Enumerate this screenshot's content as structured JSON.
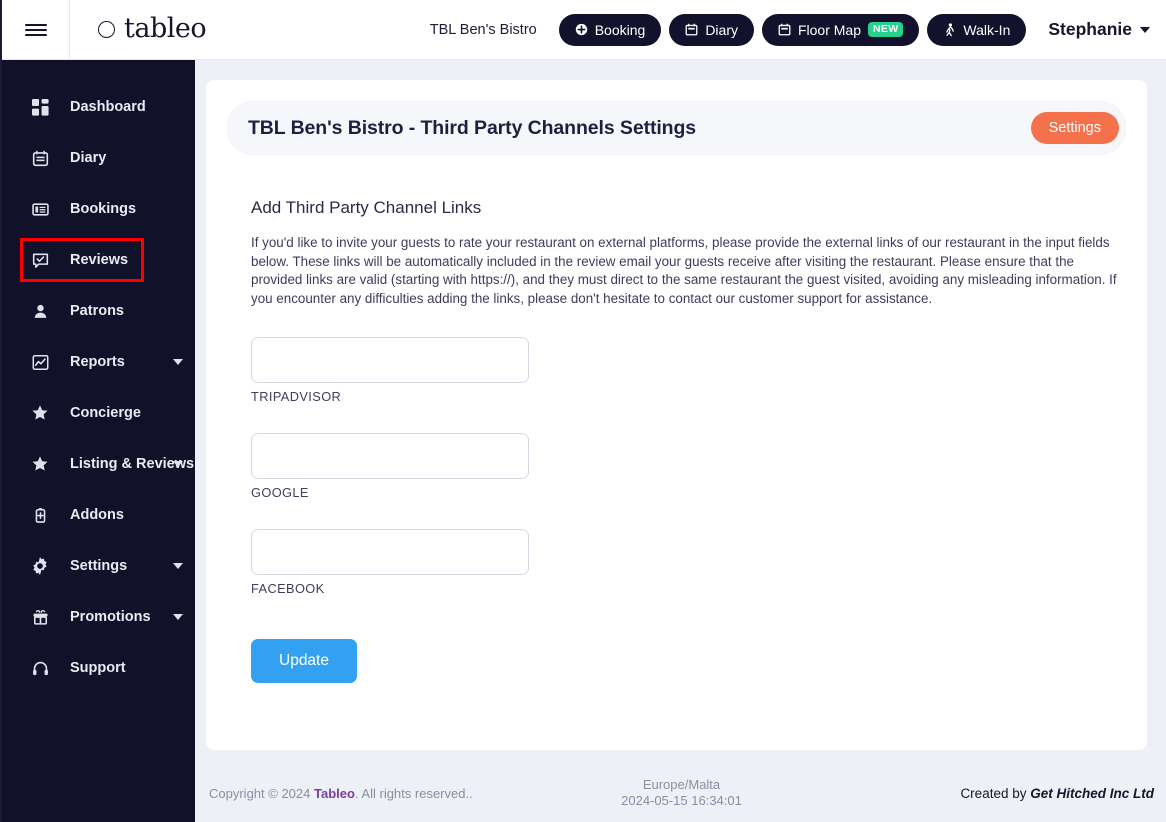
{
  "topbar": {
    "menu_icon": "hamburger-icon",
    "logo_text": "tableo",
    "venue_name": "TBL Ben's Bistro",
    "buttons": [
      {
        "label": "Booking",
        "icon": "plus-circle-icon",
        "badge": null
      },
      {
        "label": "Diary",
        "icon": "calendar-icon",
        "badge": null
      },
      {
        "label": "Floor Map",
        "icon": "calendar-icon",
        "badge": "NEW"
      },
      {
        "label": "Walk-In",
        "icon": "walking-person-icon",
        "badge": null
      }
    ],
    "user": {
      "name": "Stephanie",
      "caret": "chevron-down-icon"
    }
  },
  "sidebar": {
    "items": [
      {
        "label": "Dashboard",
        "icon": "grid-icon",
        "caret": false,
        "highlighted": false
      },
      {
        "label": "Diary",
        "icon": "calendar-icon",
        "caret": false,
        "highlighted": false
      },
      {
        "label": "Bookings",
        "icon": "book-icon",
        "caret": false,
        "highlighted": false
      },
      {
        "label": "Reviews",
        "icon": "chat-check-icon",
        "caret": false,
        "highlighted": true
      },
      {
        "label": "Patrons",
        "icon": "user-icon",
        "caret": false,
        "highlighted": false
      },
      {
        "label": "Reports",
        "icon": "chart-line-icon",
        "caret": true,
        "highlighted": false
      },
      {
        "label": "Concierge",
        "icon": "star-icon",
        "caret": false,
        "highlighted": false
      },
      {
        "label": "Listing & Reviews",
        "icon": "star-icon",
        "caret": true,
        "highlighted": false
      },
      {
        "label": "Addons",
        "icon": "battery-plus-icon",
        "caret": false,
        "highlighted": false
      },
      {
        "label": "Settings",
        "icon": "gear-icon",
        "caret": true,
        "highlighted": false
      },
      {
        "label": "Promotions",
        "icon": "gift-icon",
        "caret": true,
        "highlighted": false
      },
      {
        "label": "Support",
        "icon": "headset-icon",
        "caret": false,
        "highlighted": false
      }
    ]
  },
  "card": {
    "title": "TBL Ben's Bistro - Third Party Channels Settings",
    "settings_label": "Settings",
    "section_title": "Add Third Party Channel Links",
    "section_desc": "If you'd like to invite your guests to rate your restaurant on external platforms, please provide the external links of our restaurant in the input fields below. These links will be automatically included in the review email your guests receive after visiting the restaurant. Please ensure that the provided links are valid (starting with https://), and they must direct to the same restaurant the guest visited, avoiding any misleading information. If you encounter any difficulties adding the links, please don't hesitate to contact our customer support for assistance.",
    "fields": [
      {
        "label": "TRIPADVISOR",
        "value": "",
        "placeholder": ""
      },
      {
        "label": "GOOGLE",
        "value": "",
        "placeholder": ""
      },
      {
        "label": "FACEBOOK",
        "value": "",
        "placeholder": ""
      }
    ],
    "update_label": "Update"
  },
  "footer": {
    "copyright_prefix": "Copyright © 2024 ",
    "brand": "Tableo",
    "copyright_suffix": ". All rights reserved..",
    "timezone": "Europe/Malta",
    "datetime": "2024-05-15 16:34:01",
    "created_by_prefix": "Created by ",
    "company": "Get Hitched Inc Ltd"
  },
  "colors": {
    "sidebar_bg": "#11112a",
    "page_bg": "#eef0f7",
    "accent_orange": "#f4714c",
    "accent_blue": "#33a1f2",
    "badge_green": "#25d18c",
    "highlight_red": "#fc0000"
  }
}
